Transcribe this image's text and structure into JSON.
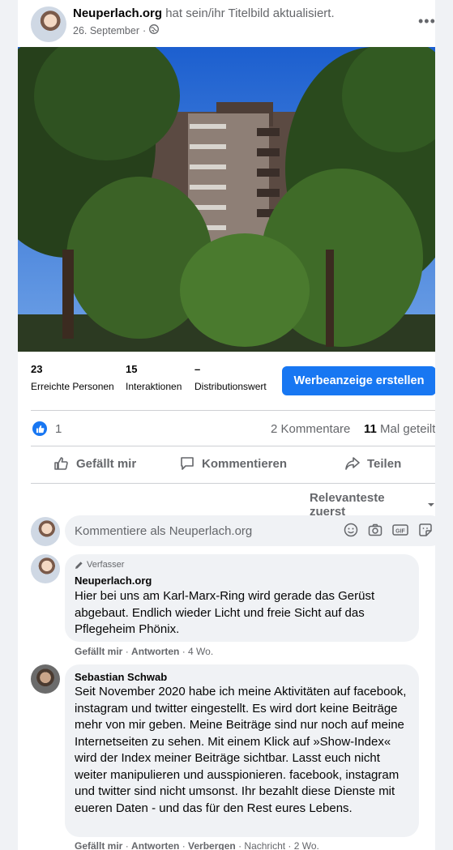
{
  "post": {
    "page_name": "Neuperlach.org",
    "action_text": " hat sein/ihr Titelbild aktualisiert.",
    "date": "26. September",
    "date_sep": " · "
  },
  "stats": [
    {
      "value": "23",
      "label": "Erreichte Personen"
    },
    {
      "value": "15",
      "label": "Interaktionen"
    },
    {
      "value": "–",
      "label": "Distributionswert"
    }
  ],
  "ad_button": "Werbeanzeige erstellen",
  "reactions": {
    "count": "1",
    "comments": "2 Kommentare",
    "shares_num": "11",
    "shares_text": "Mal geteilt"
  },
  "actions": {
    "like": "Gefällt mir",
    "comment": "Kommentieren",
    "share": "Teilen"
  },
  "sort_label": "Relevanteste zuerst",
  "comment_input": {
    "placeholder": "Kommentiere als Neuperlach.org"
  },
  "comments": [
    {
      "badge": "Verfasser",
      "author": "Neuperlach.org",
      "text": "Hier bei uns am Karl-Marx-Ring wird gerade das Gerüst abgebaut. Endlich wieder Licht und freie Sicht auf das Pflegeheim Phönix.",
      "like": "Gefällt mir",
      "reply": "Antworten",
      "time": "4 Wo."
    },
    {
      "author": "Sebastian Schwab",
      "text": "Seit November 2020 habe ich meine Aktivitäten auf facebook, instagram und twitter eingestellt. Es wird dort keine Beiträge mehr von mir geben. Meine Beiträge sind nur noch auf meine Internetseiten zu sehen. Mit einem Klick auf »Show-Index« wird der Index meiner Beiträge sichtbar. Lasst euch nicht weiter manipulieren und ausspionieren. facebook, instagram und twitter sind nicht umsonst. Ihr bezahlt diese Dienste mit eueren Daten - und das für den Rest eures Lebens.",
      "like": "Gefällt mir",
      "reply": "Antworten",
      "hide": "Verbergen",
      "message": "Nachricht",
      "time": "2 Wo."
    }
  ],
  "colors": {
    "accent": "#1877f2",
    "secondary_text": "#65676b",
    "bubble": "#f0f2f5"
  }
}
